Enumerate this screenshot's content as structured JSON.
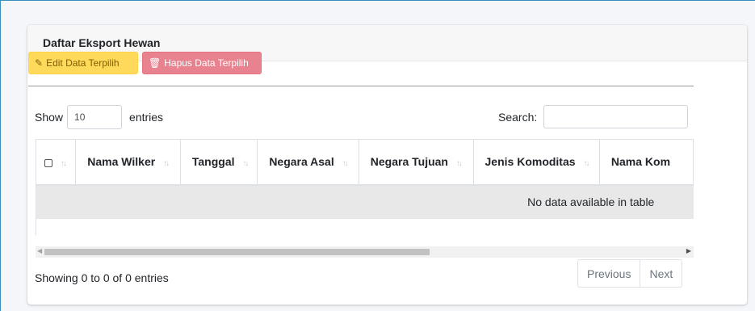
{
  "card": {
    "title": "Daftar Eksport Hewan"
  },
  "toolbar": {
    "edit_label": "Edit Data Terpilih",
    "edit_icon": "edit-icon",
    "delete_label": "Hapus Data Terpilih",
    "delete_icon": "trash-icon",
    "colors": {
      "warning": "#ffd95a",
      "danger": "#e8828f"
    }
  },
  "length": {
    "prefix": "Show",
    "value": "10",
    "suffix": "entries"
  },
  "search": {
    "label": "Search:",
    "value": ""
  },
  "table": {
    "columns": [
      {
        "label": ""
      },
      {
        "label": "Nama Wilker"
      },
      {
        "label": "Tanggal"
      },
      {
        "label": "Negara Asal"
      },
      {
        "label": "Negara Tujuan"
      },
      {
        "label": "Jenis Komoditas"
      },
      {
        "label": "Nama Kom"
      }
    ],
    "sort_arrows": "↑↓",
    "empty_message": "No data available in table"
  },
  "footer": {
    "info": "Showing 0 to 0 of 0 entries",
    "prev_label": "Previous",
    "next_label": "Next"
  }
}
